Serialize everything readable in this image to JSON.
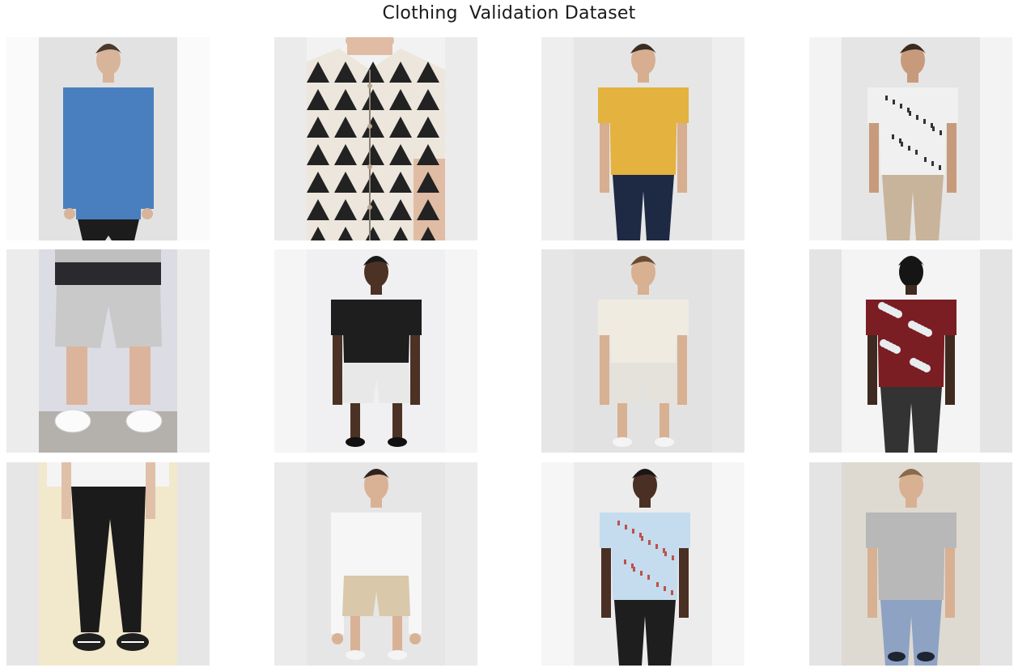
{
  "title": "Clothing  Validation Dataset",
  "grid": {
    "rows": 3,
    "cols": 4,
    "images": [
      {
        "row": 1,
        "col": 1,
        "subject": "denim-shirt-front",
        "bg": "#e2e2e2",
        "pad": "#fafafa",
        "garment": "#4a7fbf",
        "lower": "#1c1c1c",
        "skin": "#d8b49a",
        "hair": "#4a3a2e"
      },
      {
        "row": 1,
        "col": 2,
        "subject": "geometric-print-shirt-closeup",
        "bg": "#f2f2f2",
        "pad": "#ebebeb",
        "garment": "#ece6dc",
        "pattern": "#222222",
        "skin": "#e0bca4"
      },
      {
        "row": 1,
        "col": 3,
        "subject": "yellow-polo-front",
        "bg": "#e6e6e6",
        "pad": "#eeeeee",
        "garment": "#e4b23e",
        "lower": "#1e2a44",
        "skin": "#d7ae8f",
        "hair": "#3a2d24"
      },
      {
        "row": 1,
        "col": 4,
        "subject": "white-print-shirt-side",
        "bg": "#e5e5e5",
        "pad": "#f3f3f3",
        "garment": "#f0f0f0",
        "lower": "#c8b49a",
        "skin": "#c89a7c",
        "hair": "#3a2a20"
      },
      {
        "row": 2,
        "col": 1,
        "subject": "grey-shorts",
        "bg": "#dcdce4",
        "pad": "#ececec",
        "garment": "#c9c9c9",
        "lower": "#d4d0cc",
        "skin": "#dcb49c"
      },
      {
        "row": 2,
        "col": 2,
        "subject": "black-shirt-patterned-shorts",
        "bg": "#f0f0f2",
        "pad": "#f5f5f5",
        "garment": "#1e1e1e",
        "lower": "#e8e8e8",
        "skin": "#4c3224",
        "hair": "#1a1a1a"
      },
      {
        "row": 2,
        "col": 3,
        "subject": "cream-shirt-print-shorts",
        "bg": "#e2e2e2",
        "pad": "#e6e6e6",
        "garment": "#efebe0",
        "lower": "#e4e2da",
        "skin": "#d8b092",
        "hair": "#6a4a30"
      },
      {
        "row": 2,
        "col": 4,
        "subject": "floral-shirt-back",
        "bg": "#f4f4f4",
        "pad": "#e4e4e4",
        "garment": "#7a1e24",
        "pattern": "#e8eef0",
        "skin": "#3e2a20",
        "hair": "#151515"
      },
      {
        "row": 3,
        "col": 1,
        "subject": "black-jeans",
        "bg": "#f2e8cc",
        "pad": "#e6e6e6",
        "garment": "#1b1b1b",
        "lower": "#ece6d0",
        "skin": "#e0c0a8"
      },
      {
        "row": 3,
        "col": 2,
        "subject": "white-shirt-khaki-shorts",
        "bg": "#e6e6e6",
        "pad": "#ebebeb",
        "garment": "#f6f6f6",
        "lower": "#d9c9aa",
        "skin": "#d9b296",
        "hair": "#2e241e"
      },
      {
        "row": 3,
        "col": 3,
        "subject": "light-blue-print-shirt-side",
        "bg": "#ececec",
        "pad": "#f6f6f6",
        "garment": "#c4dcee",
        "lower": "#1e1e1e",
        "skin": "#4a3024",
        "hair": "#1a1614"
      },
      {
        "row": 3,
        "col": 4,
        "subject": "grey-tee-blue-pants",
        "bg": "#dedad2",
        "pad": "#e4e4e4",
        "garment": "#b8b8b8",
        "lower": "#8ea2c4",
        "skin": "#d8b092",
        "hair": "#8a6a4a"
      }
    ]
  }
}
